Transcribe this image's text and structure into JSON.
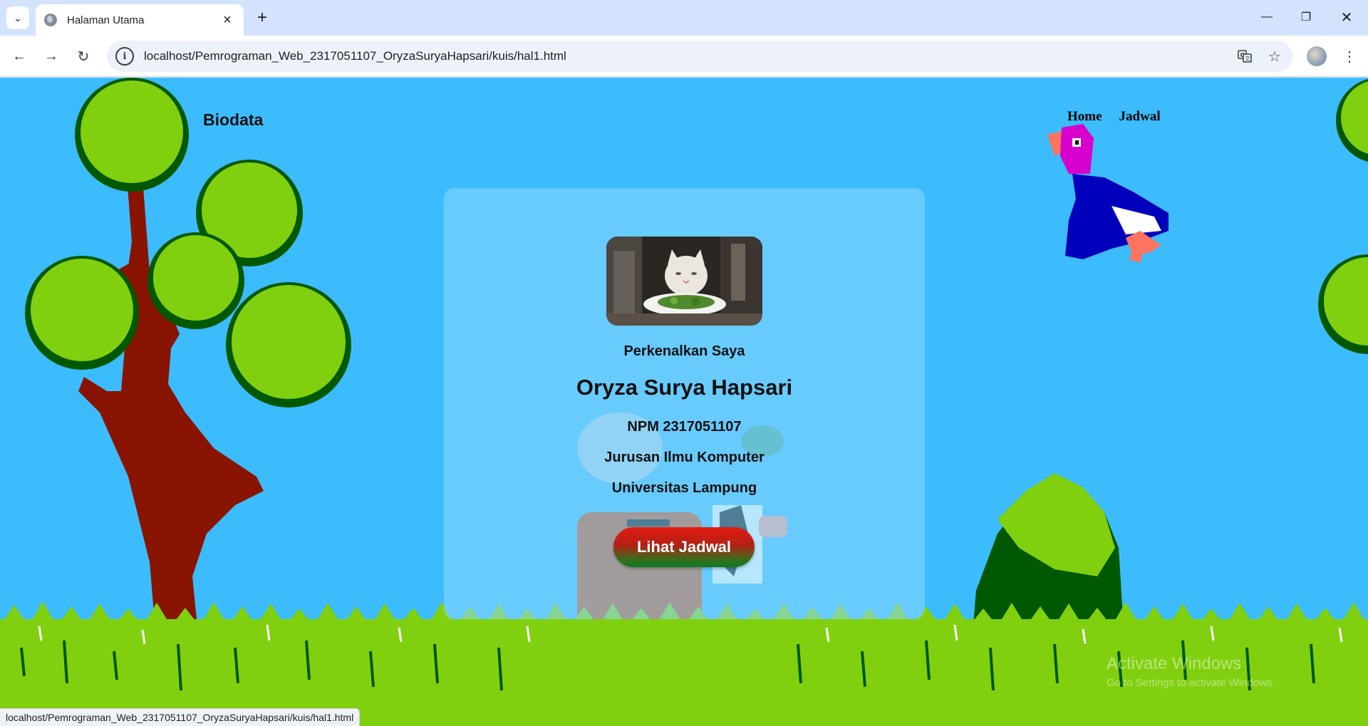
{
  "browser": {
    "tab_title": "Halaman Utama",
    "url": "localhost/Pemrograman_Web_2317051107_OryzaSuryaHapsari/kuis/hal1.html",
    "status_url": "localhost/Pemrograman_Web_2317051107_OryzaSuryaHapsari/kuis/hal1.html",
    "icons": {
      "tab_menu": "chevron-down-icon",
      "close": "close-icon",
      "new_tab": "plus-icon",
      "back": "back-arrow-icon",
      "forward": "forward-arrow-icon",
      "reload": "reload-icon",
      "site_info": "info-icon",
      "translate": "translate-icon",
      "bookmark": "star-icon",
      "menu": "more-vertical-icon"
    }
  },
  "page": {
    "brand": "Biodata",
    "nav": [
      "Home",
      "Jadwal"
    ],
    "card": {
      "greeting": "Perkenalkan Saya",
      "name": "Oryza Surya Hapsari",
      "npm": "NPM 2317051107",
      "major": "Jurusan Ilmu Komputer",
      "university": "Universitas Lampung",
      "button_label": "Lihat Jadwal"
    },
    "watermark": {
      "line1": "Activate Windows",
      "line2": "Go to Settings to activate Windows."
    }
  },
  "colors": {
    "sky": "#3cbcfc",
    "tree_leaf": "#80d010",
    "tree_dark": "#005800",
    "trunk": "#881400",
    "button_red": "#e41b13",
    "button_green": "#0b7a23"
  }
}
